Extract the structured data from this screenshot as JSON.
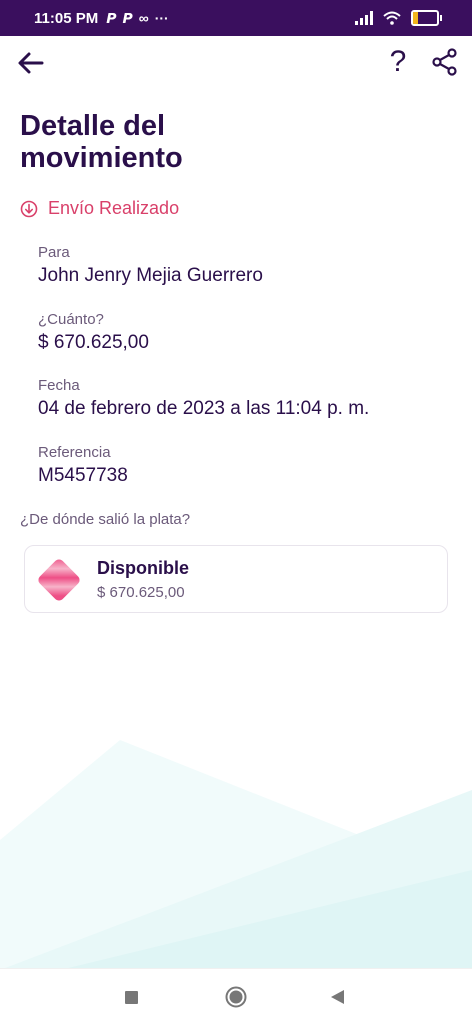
{
  "status_bar": {
    "time": "11:05 PM",
    "app_icons": [
      "paypal-icon",
      "paypal-icon",
      "infinity-icon",
      "more-dots-icon"
    ],
    "battery": "19",
    "battery_level": 0.19
  },
  "header": {
    "title": "Detalle del movimiento",
    "help_label": "?"
  },
  "status": {
    "label": "Envío Realizado",
    "icon": "arrow-down-circle-icon",
    "color": "#d9406a"
  },
  "details": {
    "to_label": "Para",
    "to_value": "John Jenry Mejia Guerrero",
    "amount_label": "¿Cuánto?",
    "amount_value": "$ 670.625,00",
    "date_label": "Fecha",
    "date_value": "04 de febrero de 2023 a las 11:04 p. m.",
    "ref_label": "Referencia",
    "ref_value": "M5457738"
  },
  "source": {
    "label": "¿De dónde salió la plata?",
    "account_name": "Disponible",
    "account_amount": "$ 670.625,00"
  },
  "colors": {
    "brand": "#3a0f5e",
    "text": "#2a0f4a",
    "accent_pink": "#d9406a"
  }
}
